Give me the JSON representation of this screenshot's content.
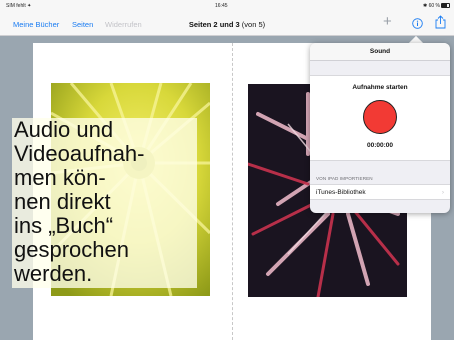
{
  "statusbar": {
    "carrier": "SIM fehlt ✦",
    "time": "16:45",
    "battery": "✱ 60 %"
  },
  "navbar": {
    "links": [
      "Meine Bücher",
      "Seiten",
      "Widerrufen"
    ],
    "title": "Seiten 2 und 3",
    "title_sub": " (von 5)",
    "icons": {
      "add": "plus-icon",
      "info": "info-icon",
      "share": "share-icon"
    }
  },
  "caption": {
    "lines": [
      "Audio und",
      "Videoaufnah-",
      "men kön-",
      "nen direkt",
      "ins „Buch“",
      "gesprochen",
      "werden."
    ]
  },
  "popover": {
    "title": "Sound",
    "record_label": "Aufnahme starten",
    "timer": "00:00:00",
    "section_header": "VON IPAD IMPORTIEREN",
    "import_row": "iTunes-Bibliothek",
    "record_color": "#f23a34"
  },
  "colors": {
    "accent": "#1a7cf2",
    "background": "#9aa6b0"
  }
}
